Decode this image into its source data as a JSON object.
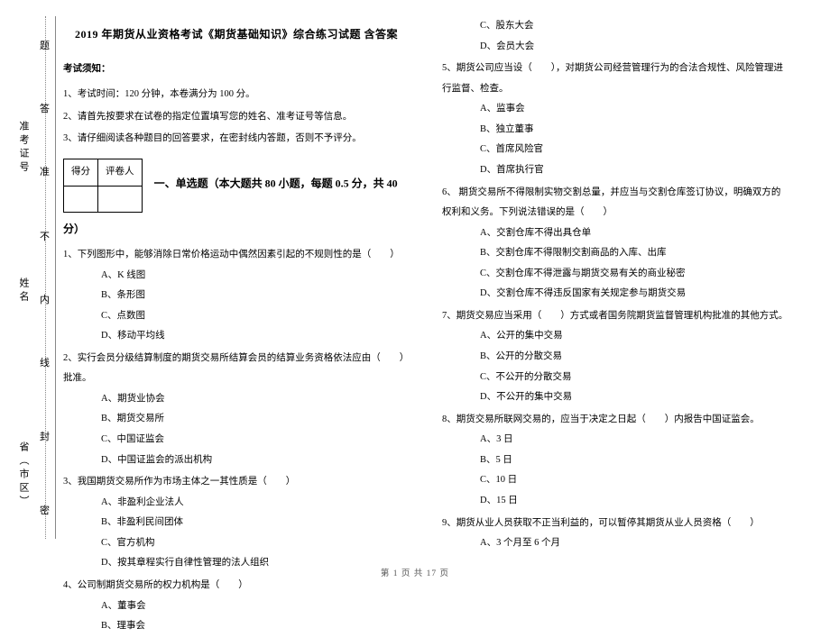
{
  "binding": {
    "labels": [
      "省（市区）",
      "姓名",
      "准考证号"
    ],
    "marks": [
      "密",
      "封",
      "线",
      "内",
      "不",
      "准",
      "答",
      "题"
    ]
  },
  "title": "2019 年期货从业资格考试《期货基础知识》综合练习试题 含答案",
  "noticeHeader": "考试须知：",
  "notices": [
    "1、考试时间：120 分钟，本卷满分为 100 分。",
    "2、请首先按要求在试卷的指定位置填写您的姓名、准考证号等信息。",
    "3、请仔细阅读各种题目的回答要求，在密封线内答题，否则不予评分。"
  ],
  "scoreTable": {
    "h1": "得分",
    "h2": "评卷人"
  },
  "sectionTitle": "一、单选题（本大题共 80 小题，每题 0.5 分，共 40 分）",
  "leftQuestions": [
    {
      "stem": "1、下列图形中，能够消除日常价格运动中偶然因素引起的不规则性的是（　　）",
      "opts": [
        "A、K 线图",
        "B、条形图",
        "C、点数图",
        "D、移动平均线"
      ]
    },
    {
      "stem": "2、实行会员分级结算制度的期货交易所结算会员的结算业务资格依法应由（　　）批准。",
      "opts": [
        "A、期货业协会",
        "B、期货交易所",
        "C、中国证监会",
        "D、中国证监会的派出机构"
      ]
    },
    {
      "stem": "3、我国期货交易所作为市场主体之一其性质是（　　）",
      "opts": [
        "A、非盈利企业法人",
        "B、非盈利民间团体",
        "C、官方机构",
        "D、按其章程实行自律性管理的法人组织"
      ]
    },
    {
      "stem": "4、公司制期货交易所的权力机构是（　　）",
      "opts": [
        "A、董事会",
        "B、理事会"
      ]
    }
  ],
  "rightExtraOpts": [
    "C、股东大会",
    "D、会员大会"
  ],
  "rightQuestions": [
    {
      "stem": "5、期货公司应当设（　　），对期货公司经营管理行为的合法合规性、风险管理进行监督、检查。",
      "opts": [
        "A、监事会",
        "B、独立董事",
        "C、首席风险官",
        "D、首席执行官"
      ]
    },
    {
      "stem": "6、 期货交易所不得限制实物交割总量，并应当与交割仓库签订协议，明确双方的权利和义务。下列说法错误的是（　　）",
      "opts": [
        "A、交割仓库不得出具仓单",
        "B、交割仓库不得限制交割商品的入库、出库",
        "C、交割仓库不得泄露与期货交易有关的商业秘密",
        "D、交割仓库不得违反国家有关规定参与期货交易"
      ]
    },
    {
      "stem": "7、期货交易应当采用（　　）方式或者国务院期货监督管理机构批准的其他方式。",
      "opts": [
        "A、公开的集中交易",
        "B、公开的分散交易",
        "C、不公开的分散交易",
        "D、不公开的集中交易"
      ]
    },
    {
      "stem": "8、期货交易所联网交易的，应当于决定之日起（　　）内报告中国证监会。",
      "opts": [
        "A、3 日",
        "B、5 日",
        "C、10 日",
        "D、15 日"
      ]
    },
    {
      "stem": "9、期货从业人员获取不正当利益的，可以暂停其期货从业人员资格（　　）",
      "opts": [
        "A、3 个月至 6 个月"
      ]
    }
  ],
  "footer": "第 1 页 共 17 页"
}
